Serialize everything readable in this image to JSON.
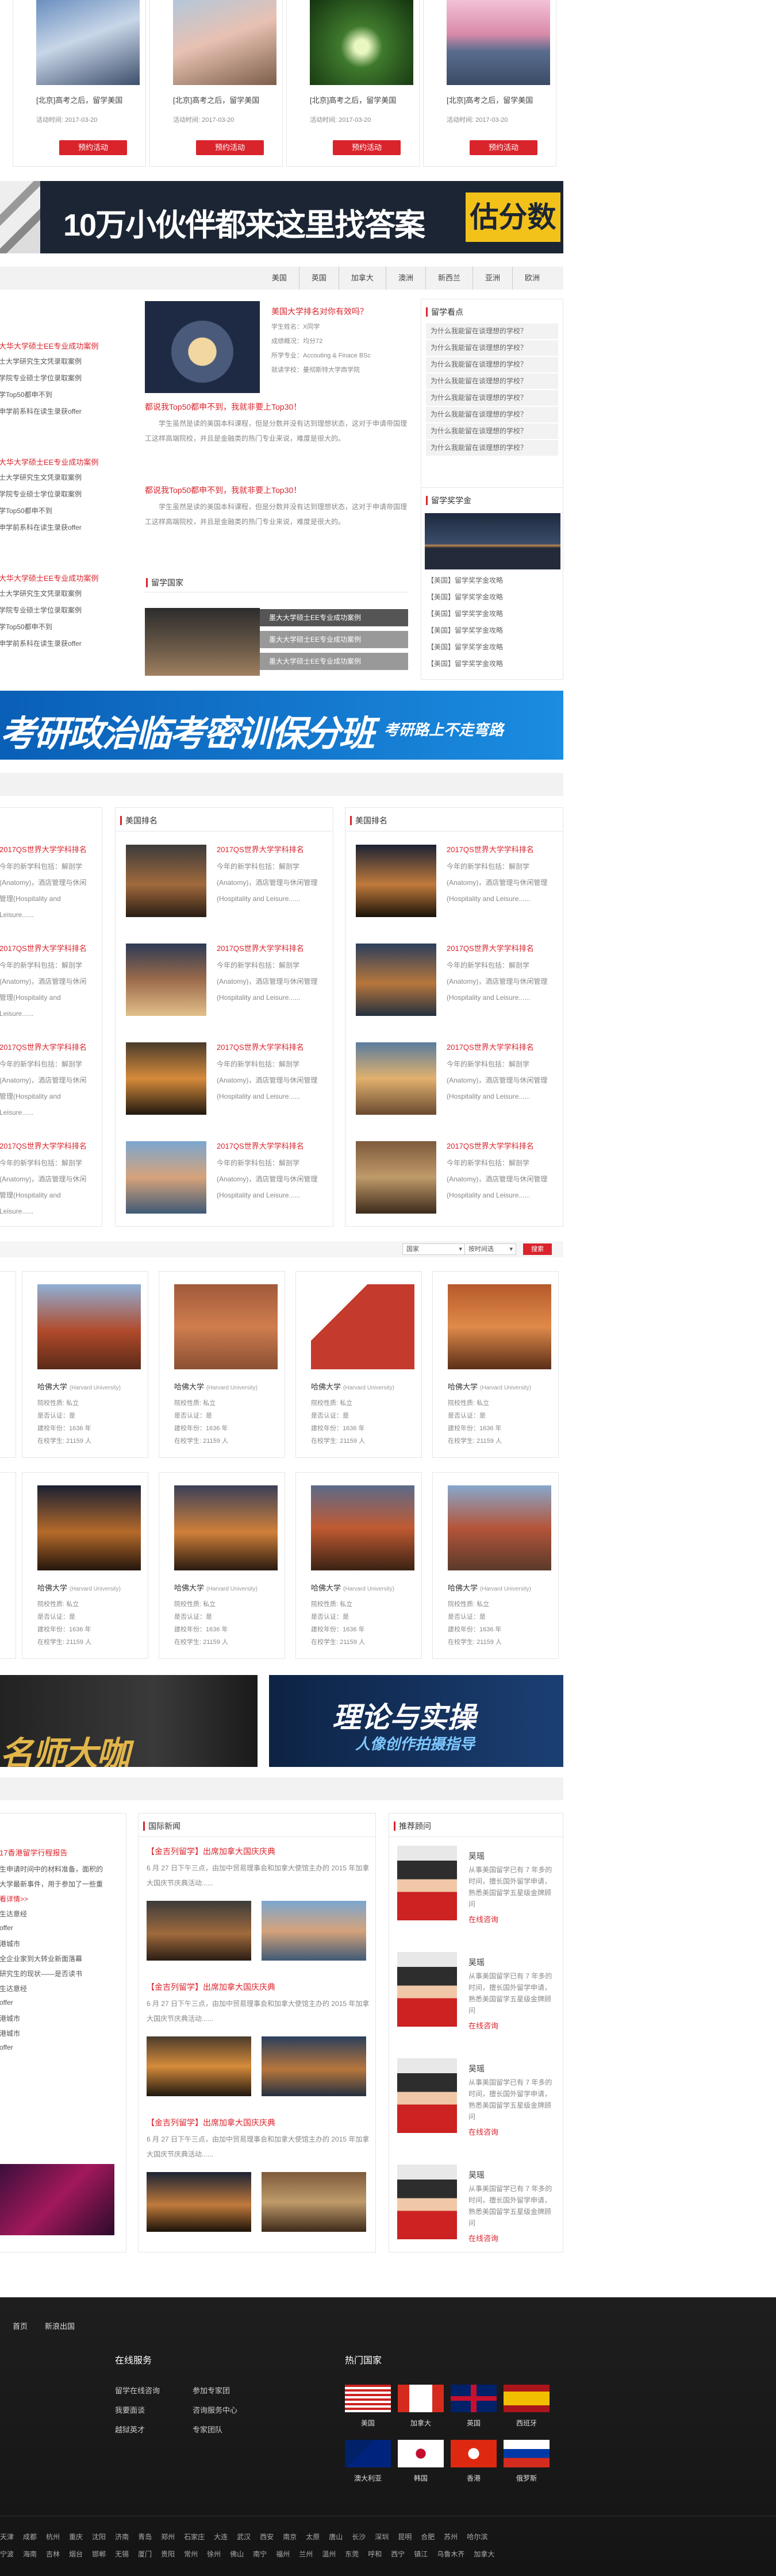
{
  "activities": [
    {
      "title": "[北京]高考之后，留学美国",
      "date": "活动时间: 2017-03-20",
      "button": "预约活动"
    },
    {
      "title": "[北京]高考之后，留学美国",
      "date": "活动时间: 2017-03-20",
      "button": "预约活动"
    },
    {
      "title": "[北京]高考之后，留学美国",
      "date": "活动时间: 2017-03-20",
      "button": "预约活动"
    },
    {
      "title": "[北京]高考之后，留学美国",
      "date": "活动时间: 2017-03-20",
      "button": "预约活动"
    }
  ],
  "banner1": {
    "text": "10万小伙伴都来这里找答案",
    "tag": "估分数"
  },
  "country_nav": [
    "美国",
    "英国",
    "加拿大",
    "澳洲",
    "新西兰",
    "亚洲",
    "欧洲"
  ],
  "left_cases": [
    {
      "title": "大华大学硕士EE专业成功案例",
      "lines": [
        "士大学研究生文凭录取案例",
        "学院专业硕士学位录取案例",
        "学Top50都申不到",
        "申学前系科在读生录获offer"
      ]
    },
    {
      "title": "大华大学硕士EE专业成功案例",
      "lines": [
        "士大学研究生文凭录取案例",
        "学院专业硕士学位录取案例",
        "学Top50都申不到",
        "申学前系科在读生录获offer"
      ]
    },
    {
      "title": "大华大学硕士EE专业成功案例",
      "lines": [
        "士大学研究生文凭录取案例",
        "学院专业硕士学位录取案例",
        "学Top50都申不到",
        "申学前系科在读生录获offer"
      ]
    }
  ],
  "featured": {
    "title": "美国大学排名对你有效吗？",
    "rows": [
      "学生姓名：X同学",
      "成绩概况：均分72",
      "所学专业：Accouting & Finace BSc",
      "就读学校：曼彻斯特大学商学院"
    ]
  },
  "news_items": [
    {
      "title": "都说我Top50都申不到，我就非要上Top30！",
      "body": "学生虽然是读的美国本科课程，但是分数并没有达到理想状态，这对于申请帝国理工这样高端院校，并且是金融类的热门专业来说，难度是很大的。"
    },
    {
      "title": "都说我Top50都申不到，我就非要上Top30！",
      "body": "学生虽然是读的美国本科课程，但是分数并没有达到理想状态，这对于申请帝国理工这样高端院校，并且是金融类的热门专业来说，难度是很大的。"
    }
  ],
  "study_countries": {
    "title": "留学国家",
    "items": [
      "墨大大学硕士EE专业成功案例",
      "墨大大学硕士EE专业成功案例",
      "墨大大学硕士EE专业成功案例"
    ]
  },
  "right_top": {
    "title": "留学看点",
    "items": [
      "为什么我能留在谈理想的学校？",
      "为什么我能留在谈理想的学校？",
      "为什么我能留在谈理想的学校？",
      "为什么我能留在谈理想的学校？",
      "为什么我能留在谈理想的学校？",
      "为什么我能留在谈理想的学校？",
      "为什么我能留在谈理想的学校？",
      "为什么我能留在谈理想的学校？"
    ]
  },
  "scholarship": {
    "title": "留学奖学金",
    "items": [
      "【美国】留学奖学金攻略",
      "【美国】留学奖学金攻略",
      "【美国】留学奖学金攻略",
      "【美国】留学奖学金攻略",
      "【美国】留学奖学金攻略",
      "【美国】留学奖学金攻略"
    ]
  },
  "banner2": {
    "text": "考研政治临考密训保分班",
    "sub": "考研路上不走弯路"
  },
  "rank_col_titles": [
    "美国排名",
    "美国排名"
  ],
  "rank_item": {
    "title": "2017QS世界大学学科排名",
    "body": "今年的新学科包括：解剖学(Anatomy)，酒店管理与休闲管理(Hospitality and Leisure......"
  },
  "rank_left_item": {
    "title": "2017QS世界大学学科排名",
    "body": "今年的新学科包括：解剖学(Anatomy)，酒店管理与休闲管理(Hospitality and Leisure......"
  },
  "filters": {
    "country": "国家",
    "rank": "按时间选",
    "search": "搜索"
  },
  "universities": [
    {
      "name": "哈佛大学",
      "en": "(Harvard University)",
      "type": "院校性质: 私立",
      "public": "是否认证：是",
      "founded": "建校年份：1636 年",
      "students": "在校学生: 21159 人"
    },
    {
      "name": "哈佛大学",
      "en": "(Harvard University)",
      "type": "院校性质: 私立",
      "public": "是否认证：是",
      "founded": "建校年份：1636 年",
      "students": "在校学生: 21159 人"
    },
    {
      "name": "哈佛大学",
      "en": "(Harvard University)",
      "type": "院校性质: 私立",
      "public": "是否认证：是",
      "founded": "建校年份：1636 年",
      "students": "在校学生: 21159 人"
    },
    {
      "name": "哈佛大学",
      "en": "(Harvard University)",
      "type": "院校性质: 私立",
      "public": "是否认证：是",
      "founded": "建校年份：1636 年",
      "students": "在校学生: 21159 人"
    }
  ],
  "banner3a": {
    "text": "名师大咖"
  },
  "banner3b": {
    "text": "理论与实操",
    "sub": "人像创作拍摄指导"
  },
  "left_news": {
    "title": "17香港留学行程报告",
    "lines": [
      "生申请时间中的材料准备，面积的",
      "大学最新事件，用于参加了一些重",
      "看详情>>",
      "生达意经",
      "offer",
      "港城市",
      "全企业家到大转业新面落幕",
      "研究生的现状——是否读书",
      "生达意经",
      "offer",
      "港城市",
      "港城市",
      "offer"
    ]
  },
  "intl_news": {
    "title": "国际新闻",
    "items": [
      {
        "title": "【金吉列留学】出席加拿大国庆庆典",
        "body": "6 月 27 日下午三点，由加中贸易理事会和加拿大使馆主办的 2015 年加拿大国庆节庆典活动......"
      },
      {
        "title": "【金吉列留学】出席加拿大国庆庆典",
        "body": "6 月 27 日下午三点，由加中贸易理事会和加拿大使馆主办的 2015 年加拿大国庆节庆典活动......"
      },
      {
        "title": "【金吉列留学】出席加拿大国庆庆典",
        "body": "6 月 27 日下午三点，由加中贸易理事会和加拿大使馆主办的 2015 年加拿大国庆节庆典活动......"
      }
    ]
  },
  "advisors": {
    "title": "推荐顾问",
    "items": [
      {
        "name": "吴瑶",
        "desc": "从事美国留学已有 7 年多的时间，擅长国外留学申请，熟悉美国留学五星级金牌顾问",
        "cta": "在线咨询"
      },
      {
        "name": "吴瑶",
        "desc": "从事美国留学已有 7 年多的时间，擅长国外留学申请，熟悉美国留学五星级金牌顾问",
        "cta": "在线咨询"
      },
      {
        "name": "吴瑶",
        "desc": "从事美国留学已有 7 年多的时间，擅长国外留学申请，熟悉美国留学五星级金牌顾问",
        "cta": "在线咨询"
      },
      {
        "name": "吴瑶",
        "desc": "从事美国留学已有 7 年多的时间，擅长国外留学申请，熟悉美国留学五星级金牌顾问",
        "cta": "在线咨询"
      }
    ]
  },
  "footer": {
    "top_links": [
      "首页",
      "新浪出国"
    ],
    "online_title": "在线服务",
    "online_col1": [
      "留学在线咨询",
      "我要面谈",
      "越狱英才"
    ],
    "online_col2": [
      "参加专家团",
      "咨询服务中心",
      "专家团队"
    ],
    "hot_title": "热门国家",
    "flags": [
      "美国",
      "加拿大",
      "英国",
      "西班牙",
      "澳大利亚",
      "韩国",
      "香港",
      "俄罗斯"
    ],
    "cities1": [
      "天津",
      "成都",
      "杭州",
      "重庆",
      "沈阳",
      "济南",
      "青岛",
      "郑州",
      "石家庄",
      "大连",
      "武汉",
      "西安",
      "南京",
      "太原",
      "唐山",
      "长沙",
      "深圳",
      "昆明",
      "合肥",
      "苏州",
      "哈尔滨"
    ],
    "cities2": [
      "宁波",
      "海南",
      "吉林",
      "烟台",
      "邯郸",
      "无锡",
      "厦门",
      "贵阳",
      "常州",
      "徐州",
      "佛山",
      "南宁",
      "福州",
      "兰州",
      "温州",
      "东莞",
      "呼和",
      "西宁",
      "镇江",
      "乌鲁木齐",
      "加拿大"
    ]
  },
  "colors": {
    "accent": "#d9242c",
    "footer_bg": "#1a1a1a",
    "banner1_bg": "#1c2533",
    "banner2_bg": "#0f6fc6"
  }
}
